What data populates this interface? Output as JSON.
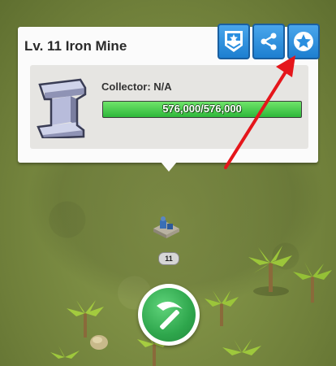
{
  "building": {
    "title": "Lv. 11 Iron Mine",
    "collector_label": "Collector: N/A",
    "storage_text": "576,000/576,000",
    "storage_fraction": 1.0,
    "level_badge": "11",
    "icon": "iron-ingot-icon"
  },
  "actions": [
    {
      "name": "rank-button",
      "icon": "badge-star-icon"
    },
    {
      "name": "share-button",
      "icon": "share-icon"
    },
    {
      "name": "favorite-button",
      "icon": "star-icon"
    }
  ],
  "main_action": {
    "icon": "pickaxe-icon"
  },
  "colors": {
    "panel": "#fbfbfb",
    "progress_fill": "#3fc84a",
    "action_button": "#2a8fe0",
    "pickaxe_button": "#2ea64c",
    "annotation_arrow": "#e5161b"
  }
}
